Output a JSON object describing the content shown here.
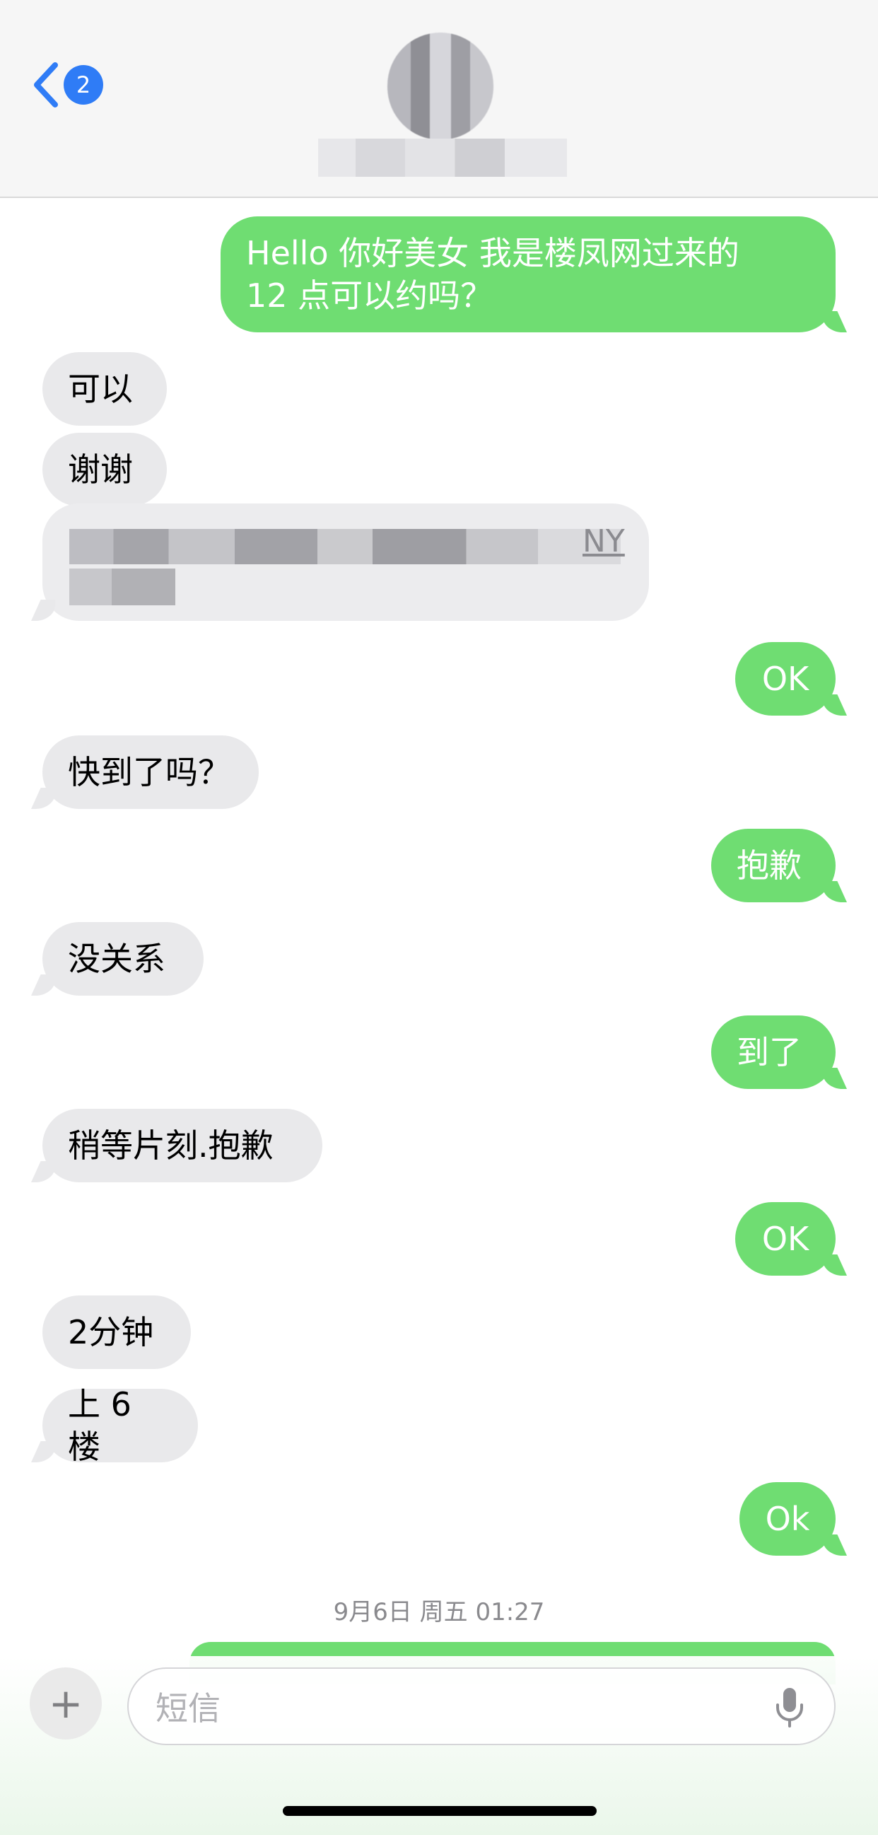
{
  "header": {
    "back_badge": "2"
  },
  "messages": [
    {
      "side": "sent",
      "text": "Hello 你好美女  我是楼凤网过来的\n12 点可以约吗？"
    },
    {
      "side": "recv",
      "text": "可以"
    },
    {
      "side": "recv",
      "text": "谢谢"
    },
    {
      "side": "recv",
      "text": "NY"
    },
    {
      "side": "sent",
      "text": "OK"
    },
    {
      "side": "recv",
      "text": "快到了吗？"
    },
    {
      "side": "sent",
      "text": "抱歉"
    },
    {
      "side": "recv",
      "text": "没关系"
    },
    {
      "side": "sent",
      "text": "到了"
    },
    {
      "side": "recv",
      "text": "稍等片刻.抱歉"
    },
    {
      "side": "sent",
      "text": "OK"
    },
    {
      "side": "recv",
      "text": "2分钟"
    },
    {
      "side": "recv",
      "text": "上 6 楼"
    },
    {
      "side": "sent",
      "text": "Ok"
    }
  ],
  "timestamp": "9月6日 周五 01:27",
  "compose": {
    "placeholder": "短信",
    "plus_label": "+"
  },
  "colors": {
    "sent_bubble": "#6fdd72",
    "recv_bubble": "#e9e9eb",
    "badge": "#2f7cf6",
    "accent": "#2f7cf6"
  },
  "icons": [
    "chevron-left-icon",
    "plus-icon",
    "microphone-icon"
  ]
}
